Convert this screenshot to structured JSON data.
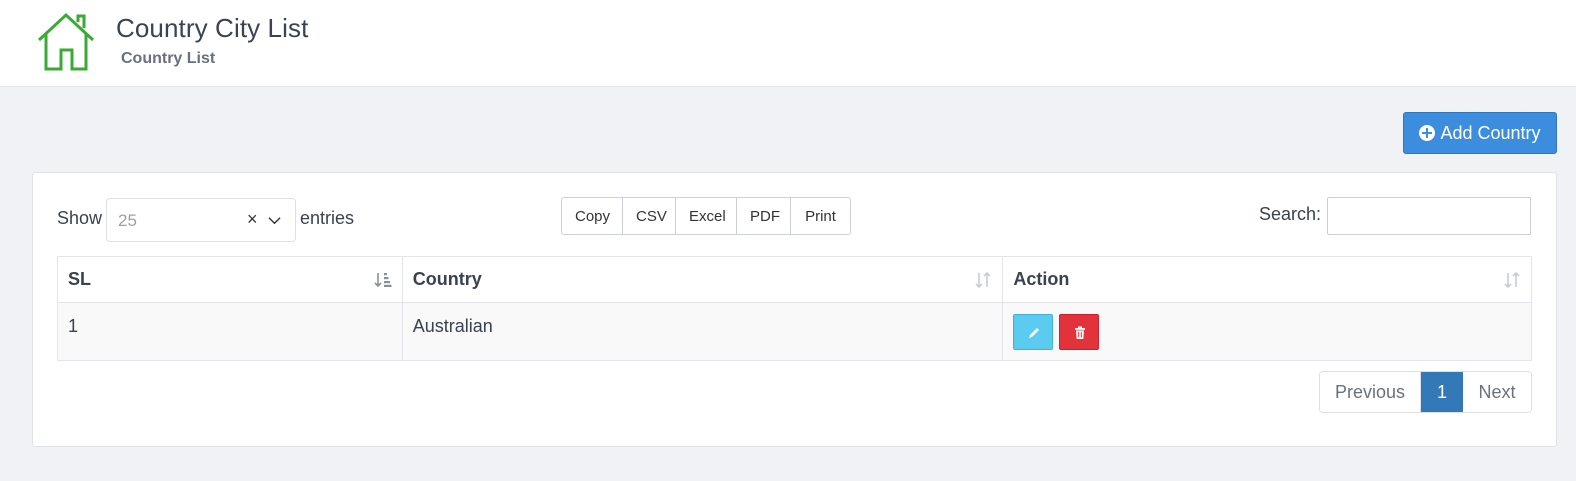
{
  "header": {
    "title": "Country City List",
    "subtitle": "Country List",
    "icon": "home-icon",
    "icon_color": "#3aaa35"
  },
  "actions": {
    "add_label": "Add Country",
    "add_icon": "plus-circle-icon",
    "add_color": "#3c8dde"
  },
  "length_control": {
    "show_label": "Show",
    "selected": "25",
    "entries_label": "entries"
  },
  "export_buttons": [
    "Copy",
    "CSV",
    "Excel",
    "PDF",
    "Print"
  ],
  "search": {
    "label": "Search:",
    "value": ""
  },
  "table": {
    "columns": [
      "SL",
      "Country",
      "Action"
    ],
    "rows": [
      {
        "sl": "1",
        "country": "Australian"
      }
    ],
    "row_actions": {
      "edit_icon": "pencil-icon",
      "edit_color": "#5bcbef",
      "delete_icon": "trash-icon",
      "delete_color": "#e2333d"
    }
  },
  "pagination": {
    "previous": "Previous",
    "current": "1",
    "next": "Next"
  }
}
